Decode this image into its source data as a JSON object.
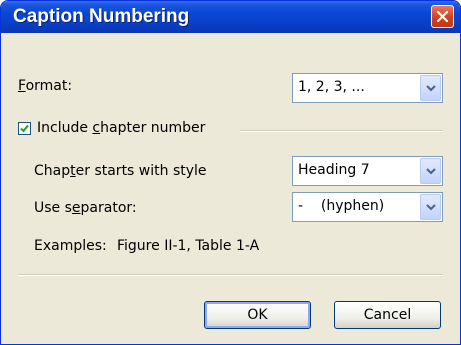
{
  "dialog": {
    "title": "Caption Numbering"
  },
  "format": {
    "label_accel": "F",
    "label_rest": "ormat:",
    "value": "1, 2, 3, ..."
  },
  "include_chapter": {
    "label_pre": "Include ",
    "label_accel": "c",
    "label_rest": "hapter number",
    "checked": true
  },
  "chapter_style": {
    "label_pre": "Chap",
    "label_accel": "t",
    "label_rest": "er starts with style",
    "value": "Heading 7"
  },
  "separator": {
    "label_pre": "Use s",
    "label_accel": "e",
    "label_rest": "parator:",
    "value": "-    (hyphen)"
  },
  "examples": {
    "label": "Examples:",
    "value": "Figure II-1, Table 1-A"
  },
  "buttons": {
    "ok_label": "OK",
    "cancel_label": "Cancel"
  },
  "icons": {
    "close": "close-icon",
    "dropdown": "chevron-down-icon",
    "check": "checkmark-icon"
  }
}
